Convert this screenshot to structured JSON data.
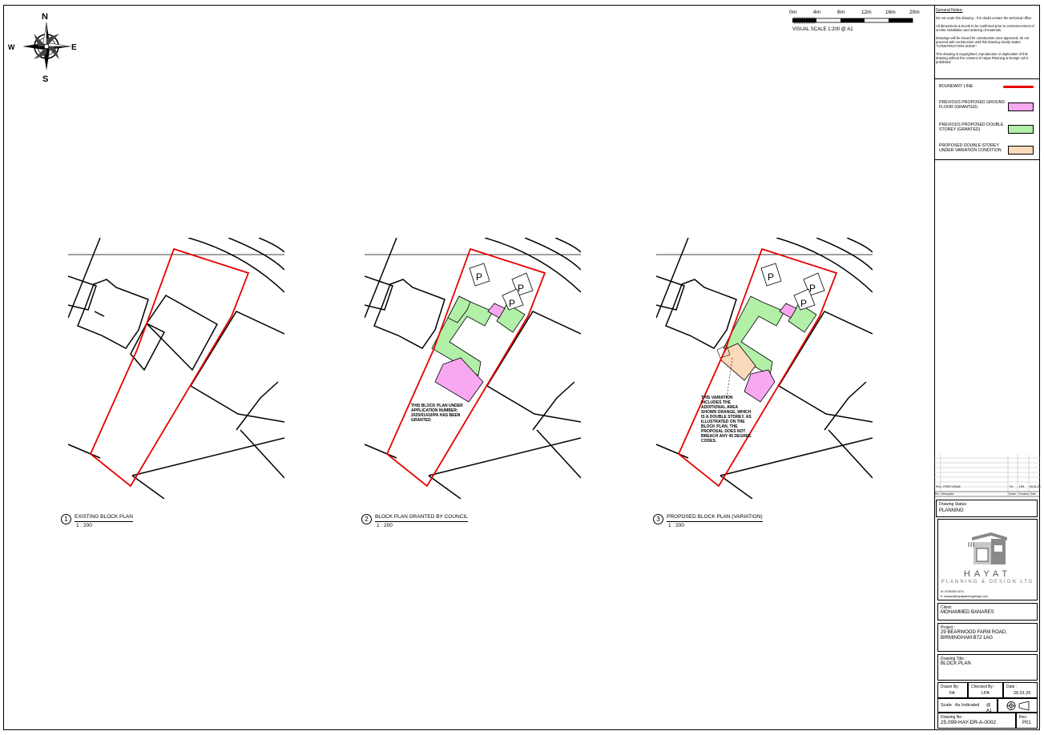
{
  "compass": {
    "n": "N",
    "s": "S",
    "e": "E",
    "w": "W"
  },
  "scale_bar": {
    "ticks": [
      "0m",
      "4m",
      "8m",
      "12m",
      "16m",
      "20m"
    ],
    "label": "VISUAL SCALE 1:200  @ A1"
  },
  "general_notes": {
    "heading": "General Notes:",
    "paragraphs": [
      "Do not scale this drawing - If in doubt contact the technical office.",
      "All dimensions & levels to be confirmed prior to commencement of on-site installation and ordering of materials.",
      "Drawings will be issued for construction once approved, do not proceed with construction until this drawing clearly states \"CONSTRUCTION ISSUE\".",
      "This drawing is copyrighted, reproduction or duplication of this drawing without the consent of Hayat Planning & Design Ltd is prohibited"
    ]
  },
  "legend": [
    {
      "label": "BOUNDARY LINE",
      "color": "#e60000",
      "kind": "line"
    },
    {
      "label": "PREVIOUS PROPOSED GROUND FLOOR (GRANTED)",
      "color": "#f7a8f0",
      "kind": "box"
    },
    {
      "label": "PREVIOUS PROPOSED DOUBLE STOREY (GRANTED)",
      "color": "#b2f0a8",
      "kind": "box"
    },
    {
      "label": "PROPOSED DOUBLE STOREY UNDER VARIATION CONDITION",
      "color": "#fbd9bb",
      "kind": "box"
    }
  ],
  "revision": {
    "rev": "P01 - FIRST ISSUE",
    "by": "FA",
    "chk": "LPA",
    "date": "26.01.26",
    "headers": [
      "Rev",
      "Description",
      "Drawn",
      "Checked",
      "Date"
    ]
  },
  "title_block": {
    "status_label": "Drawing Status:",
    "status": "PLANNING",
    "logo_name": "HAYAT",
    "logo_sub": "PLANNING & DESIGN LTD",
    "phone": "M: 07000000 0074",
    "email": "E: hassan@hayatplanningdesign.com",
    "client_label": "Client:",
    "client": "MOHAMMED BANARES",
    "project_label": "Project :",
    "project": "29 BEARWOOD FARM ROAD, BIRMINGHAM B72 1AG",
    "title_label": "Drawing Title :",
    "title": "BLOCK PLAN",
    "drawn_label": "Drawn By:",
    "drawn": "FA",
    "checked_label": "Checked By :",
    "checked": "LPA",
    "date_label": "Date :",
    "date": "26.01.26",
    "scale_label": "Scale : As Indicated",
    "scale_paper": "@ A1",
    "drawing_no_label": "Drawing No :",
    "drawing_no": "25.099-HAY-DR-A-0002",
    "rev_label": "Rev:",
    "rev": "P01"
  },
  "plans": [
    {
      "num": "1",
      "title": "EXISTING BLOCK PLAN",
      "scale": "1 : 200"
    },
    {
      "num": "2",
      "title": "BLOCK PLAN GRANTED BY COUNCIL",
      "scale": "1 : 200",
      "note": "THIS BLOCK PLAN UNDER APPLICATION NUMBER: 2025/01410/PA HAS BEEN GRANTED"
    },
    {
      "num": "3",
      "title": "PROPOSED BLOCK PLAN (VARIATION)",
      "scale": "1 : 200",
      "note": "THIS VARIATION INCLUDES THE ADDITIONAL AREA SHOWN ORANGE, WHICH IS A DOUBLE STOREY. AS ILLUSTRATED ON THE BLOCK PLAN, THE PROPOSAL DOES NOT BREACH ANY 45 DEGREE CODES."
    }
  ],
  "parking_label": "P"
}
